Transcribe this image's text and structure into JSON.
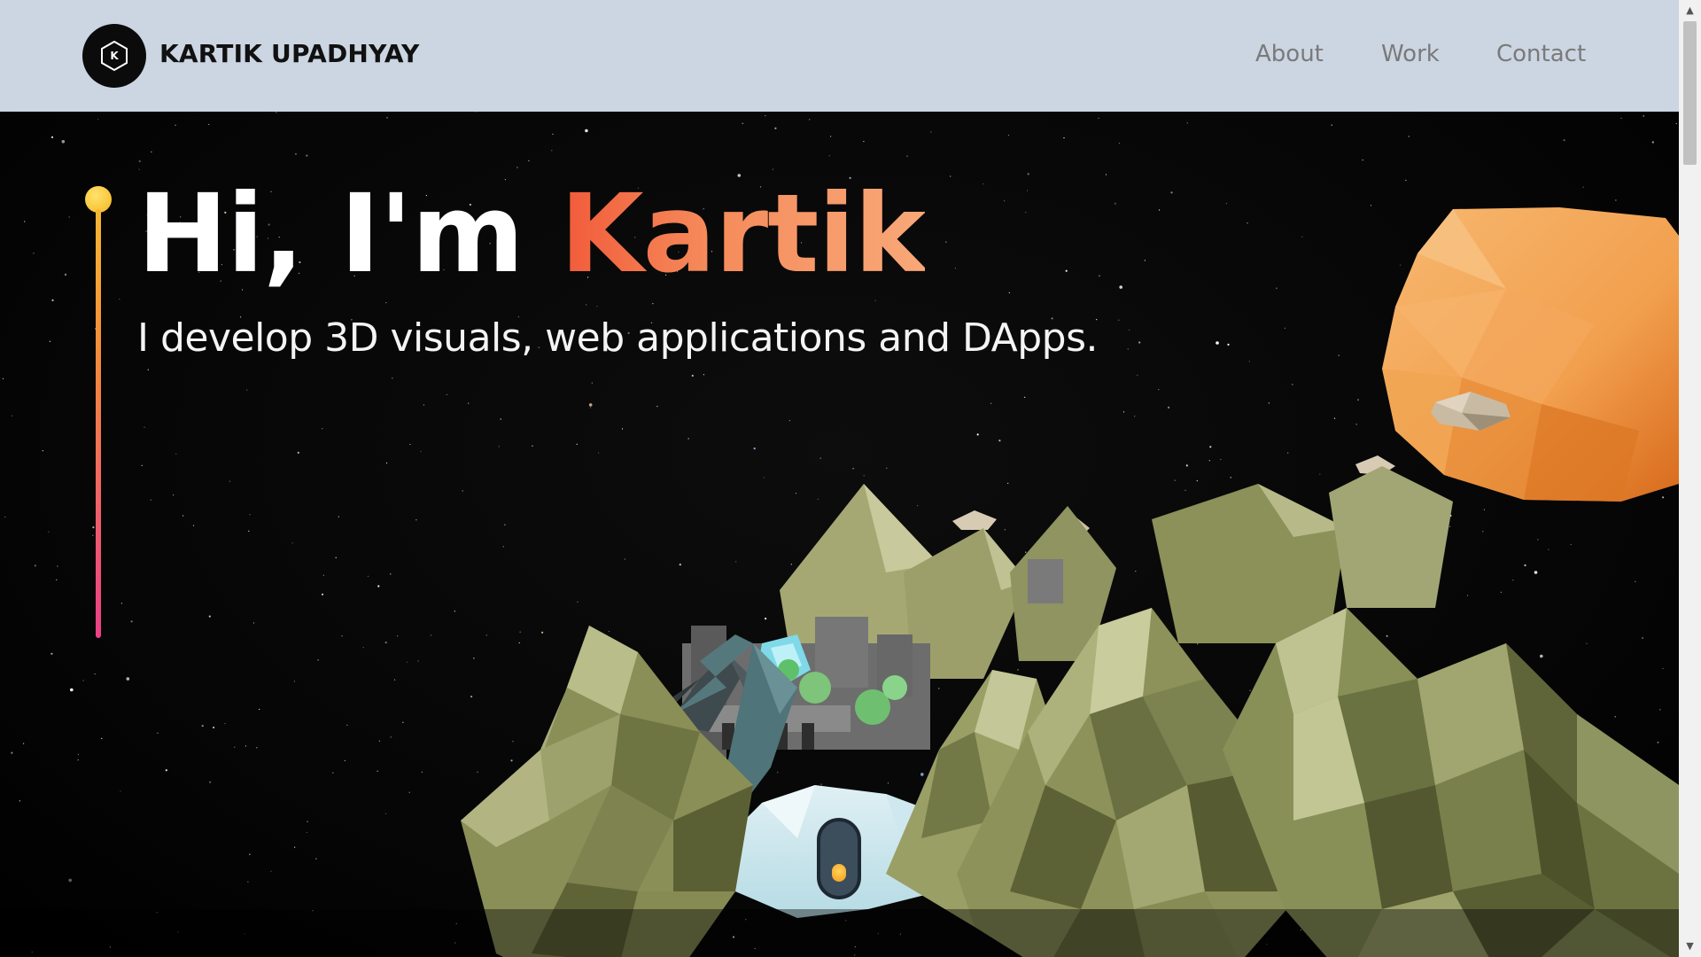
{
  "brand": {
    "logo_letter": "K",
    "name": "KARTIK UPADHYAY",
    "logo_icon": "hexagon-logo-icon"
  },
  "nav": {
    "about": "About",
    "work": "Work",
    "contact": "Contact"
  },
  "hero": {
    "greeting": "Hi, I'm ",
    "name": "Kartik",
    "tagline": "I develop 3D visuals, web applications and DApps."
  },
  "scene": {
    "description_icons": [
      "low-poly-mountains",
      "dragon",
      "castle",
      "orange-planet",
      "floating-rock"
    ]
  },
  "colors": {
    "header_bg": "#ccd5e2",
    "name_gradient_start": "#f15a3a",
    "name_gradient_end": "#f8a878",
    "timeline_top": "#f7b733",
    "timeline_bottom": "#ec3f87",
    "planet": "#f0a050"
  }
}
